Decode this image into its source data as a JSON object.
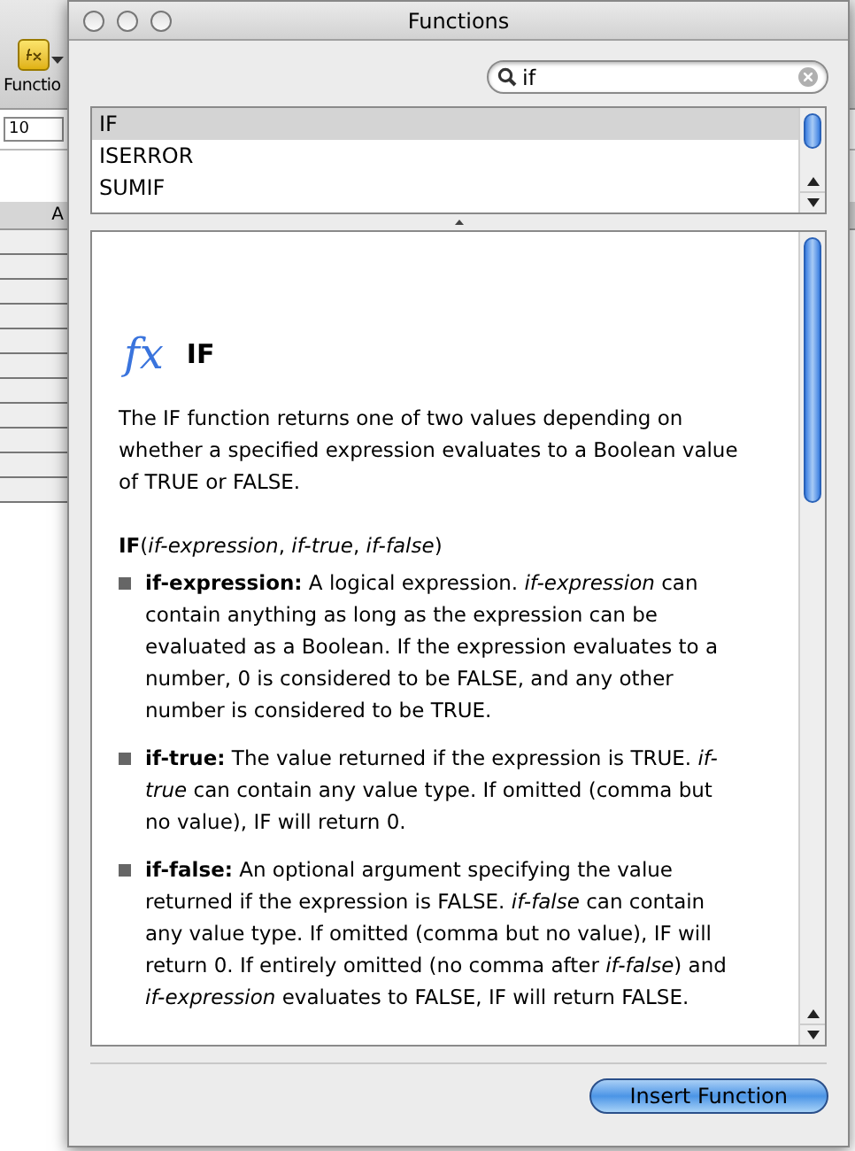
{
  "background_app": {
    "toolbar_label": "Functio",
    "cell_field": "10",
    "column_header": "A"
  },
  "window": {
    "title": "Functions"
  },
  "search": {
    "value": "if"
  },
  "function_list": [
    {
      "name": "IF",
      "selected": true
    },
    {
      "name": "ISERROR",
      "selected": false
    },
    {
      "name": "SUMIF",
      "selected": false
    }
  ],
  "description": {
    "icon_text": "fx",
    "title": "IF",
    "summary": "The IF function returns one of two values depending on whether a specified expression evaluates to a Boolean value of TRUE or FALSE.",
    "syntax": "**IF**(*if-expression*, *if-true*, *if-false*)",
    "arguments": [
      "**if-expression:**  A logical expression. *if-expression* can contain anything as long as the expression can be evaluated as a Boolean. If the expression evaluates to a number, 0 is considered to be FALSE, and any other number is considered to be TRUE.",
      "**if-true:**  The value returned if the expression is TRUE. *if-true* can contain any value type. If omitted (comma but no value), IF will return 0.",
      "**if-false:**  An optional argument specifying the value returned if the expression is FALSE. *if-false* can contain any value type. If omitted (comma but no value), IF will return 0. If entirely omitted (no comma after *if-false*) and *if-expression* evaluates to FALSE, IF will return FALSE."
    ]
  },
  "buttons": [
    "Insert Function"
  ]
}
